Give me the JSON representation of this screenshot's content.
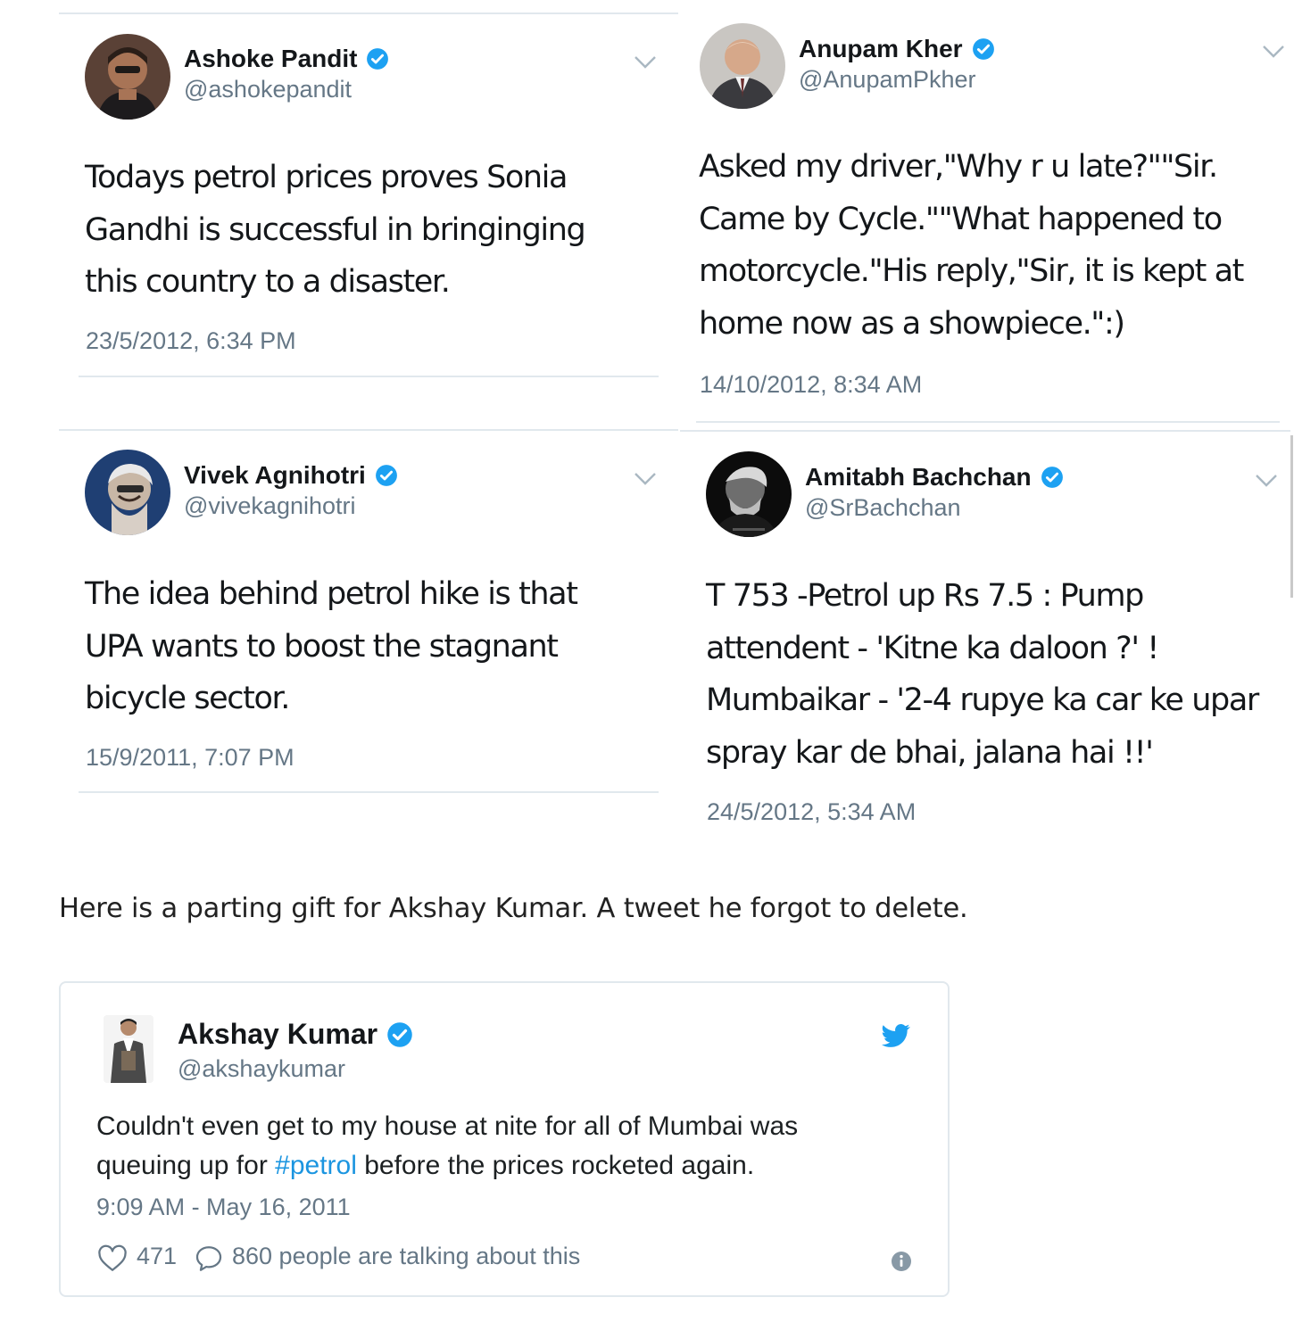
{
  "tweets": [
    {
      "name": "Ashoke Pandit",
      "handle": "@ashokepandit",
      "lines": [
        "Todays petrol prices proves Sonia",
        "Gandhi is successful in bringinging",
        "this country to a disaster."
      ],
      "time": "23/5/2012, 6:34 PM",
      "verified": true,
      "avatar_icon": "profile-photo"
    },
    {
      "name": "Anupam Kher",
      "handle": "@AnupamPkher",
      "lines": [
        "Asked my driver,\"Why r u late?\"\"Sir.",
        "Came by Cycle.\"\"What happened to",
        "motorcycle.\"His reply,\"Sir, it is kept at",
        "home now as a showpiece.\":)"
      ],
      "time": "14/10/2012, 8:34 AM",
      "verified": true,
      "avatar_icon": "profile-photo"
    },
    {
      "name": "Vivek Agnihotri",
      "handle": "@vivekagnihotri",
      "lines": [
        "The idea behind petrol hike is that",
        "UPA wants to boost the stagnant",
        "bicycle sector."
      ],
      "time": "15/9/2011, 7:07 PM",
      "verified": true,
      "avatar_icon": "profile-photo"
    },
    {
      "name": "Amitabh Bachchan",
      "handle": "@SrBachchan",
      "lines": [
        "T 753 -Petrol up Rs 7.5 : Pump",
        "attendent - 'Kitne ka daloon ?' !",
        "Mumbaikar - '2-4 rupye ka car ke upar",
        "spray kar de bhai, jalana  hai !!'"
      ],
      "time": "24/5/2012, 5:34 AM",
      "verified": true,
      "avatar_icon": "profile-photo"
    }
  ],
  "caption": "Here is a parting gift for Akshay Kumar. A tweet he forgot to delete.",
  "embed": {
    "name": "Akshay Kumar",
    "handle": "@akshaykumar",
    "line1": "Couldn't even get to my house at nite for all of Mumbai was",
    "line2_before": "queuing up for ",
    "hashtag": "#petrol",
    "line2_after": " before the prices rocketed again.",
    "time": "9:09 AM - May 16, 2011",
    "likes": "471",
    "talking": "860 people are talking about this",
    "icons": [
      "heart-icon",
      "reply-bubble-icon",
      "twitter-bird-icon",
      "info-icon"
    ]
  },
  "colors": {
    "verified": "#1da1f2",
    "twitter_blue": "#1da1f2",
    "hashtag": "#1b95e0",
    "muted_text": "#657786",
    "border": "#e1e8ed"
  }
}
